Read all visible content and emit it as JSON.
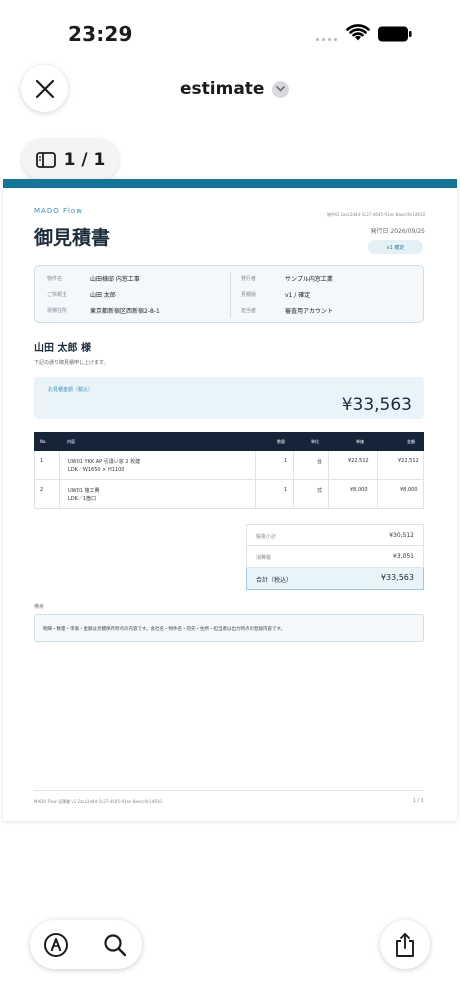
{
  "status_bar": {
    "time": "23:29"
  },
  "top_bar": {
    "title": "estimate",
    "page_indicator": "1 / 1"
  },
  "document": {
    "brand": "MADO Flow",
    "heading": "御見積書",
    "doc_id": "物件ID 2acc2d4d-5c27-4645-91ec-8aecc9c1d910",
    "issue_date": "発行日 2026/09/25",
    "version_badge": "v1 確定",
    "info": {
      "property_label": "物件名",
      "property_value": "山田様邸 内窓工事",
      "client_label": "ご依頼主",
      "client_value": "山田 太郎",
      "site_label": "現場住所",
      "site_value": "東京都新宿区西新宿2-8-1",
      "issuer_label": "発行者",
      "issuer_value": "サンプル内窓工業",
      "version_label": "見積版",
      "version_value": "v1 / 確定",
      "staff_label": "担当者",
      "staff_value": "審査用アカウント"
    },
    "customer_name": "山田 太郎 様",
    "intro": "下記の通り御見積申し上げます。",
    "total_label": "お見積金額（税込）",
    "total_amount": "¥33,563",
    "table": {
      "headers": {
        "no": "No.",
        "content": "内容",
        "qty": "数量",
        "unit": "単位",
        "unit_price": "単価",
        "amount": "金額"
      },
      "rows": [
        {
          "no": "1",
          "line1": "UW01 YKK AP 引違い窓 2 枚建",
          "line2": "LDK／W1650 × H1100",
          "qty": "1",
          "unit": "台",
          "unit_price": "¥22,512",
          "amount": "¥22,512"
        },
        {
          "no": "2",
          "line1": "UW01 施工費",
          "line2": "LDK／1箇口",
          "qty": "1",
          "unit": "式",
          "unit_price": "¥8,000",
          "amount": "¥8,000"
        }
      ]
    },
    "summary": {
      "subtotal_label": "税抜小計",
      "subtotal_value": "¥30,512",
      "tax_label": "消費税",
      "tax_value": "¥3,051",
      "grand_label": "合計（税込）",
      "grand_value": "¥33,563"
    },
    "remarks_label": "備考",
    "remarks_text": "明細・数量・単価・金額は見積保存時点の内容です。会社名・物件名・宛先・住所・担当者は出力時点の登録内容です。",
    "footer_left": "MADO Flow 見積書 v1 2acc2d4d-5c27-4645-91ec-8aecc9c1d910",
    "footer_right": "1 / 1"
  },
  "icons": {
    "close": "close-icon",
    "chevron": "chevron-down-icon",
    "sidebar": "sidebar-icon",
    "markup": "markup-pen-icon",
    "search": "search-icon",
    "share": "share-icon"
  },
  "colors": {
    "accent": "#147596",
    "table_header": "#16243a",
    "highlight": "#e8f4f9"
  }
}
